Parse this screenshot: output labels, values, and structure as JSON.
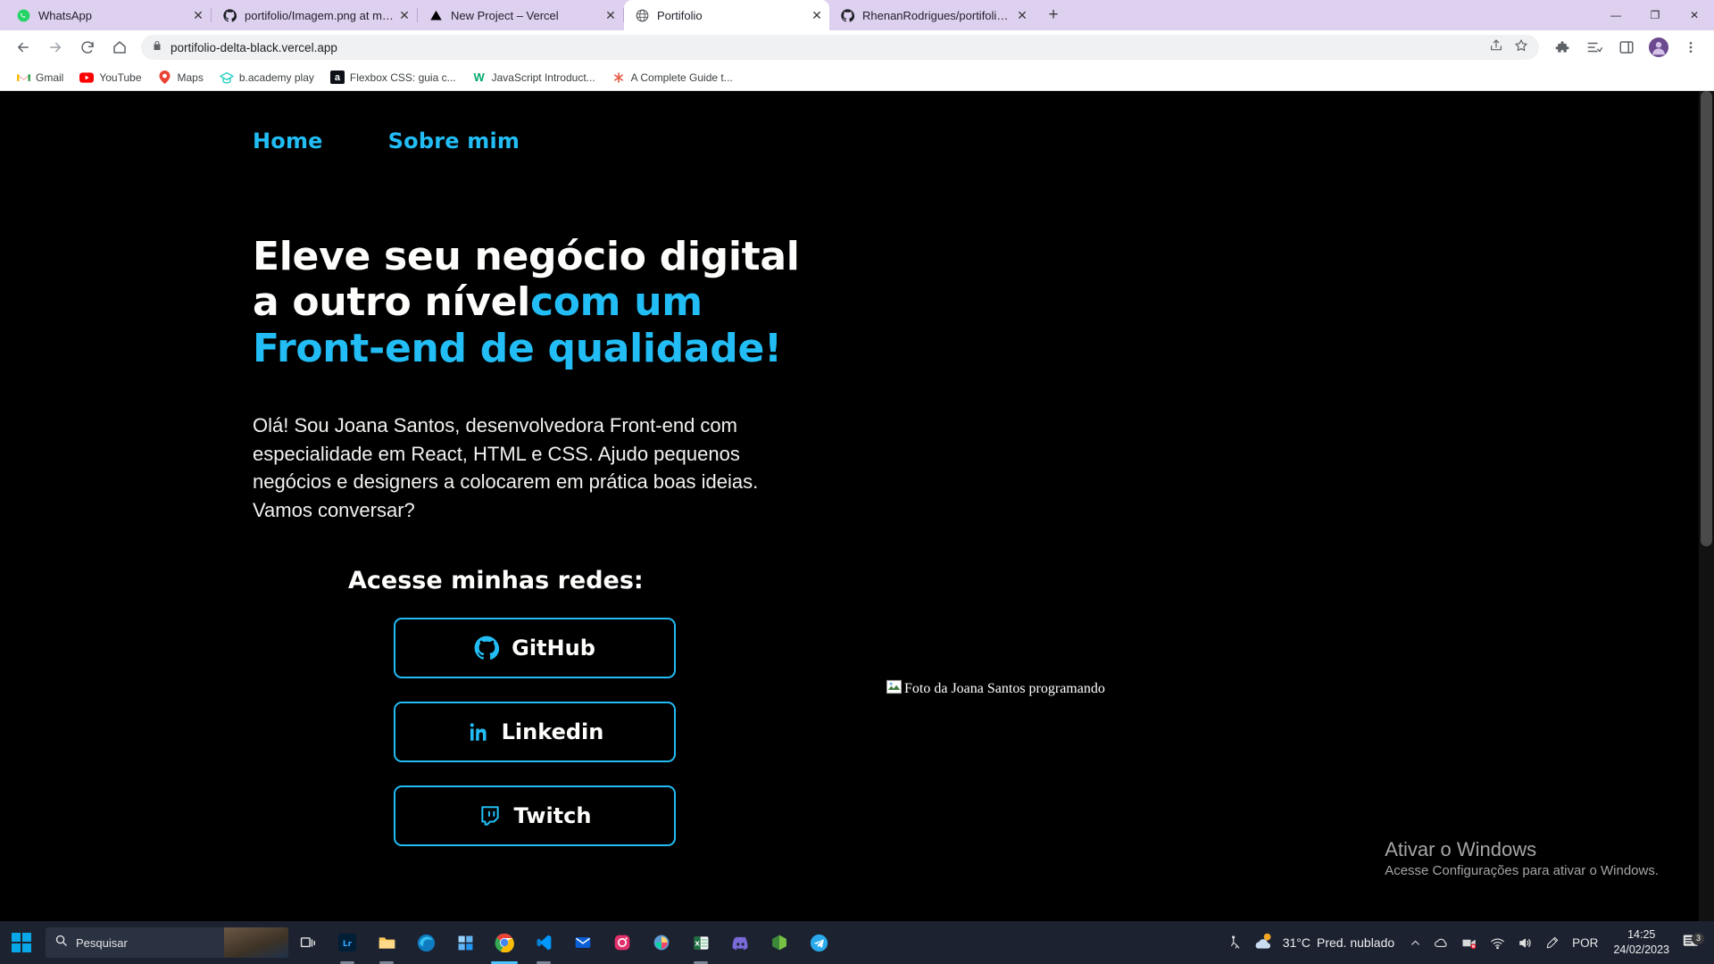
{
  "browser": {
    "tabs": [
      {
        "title": "WhatsApp",
        "favicon": "whatsapp-icon",
        "active": false
      },
      {
        "title": "portifolio/Imagem.png at main ·",
        "favicon": "github-icon",
        "active": false
      },
      {
        "title": "New Project – Vercel",
        "favicon": "vercel-icon",
        "active": false
      },
      {
        "title": "Portifolio",
        "favicon": "globe-icon",
        "active": true
      },
      {
        "title": "RhenanRodrigues/portifolio: Proj",
        "favicon": "github-icon",
        "active": false
      }
    ],
    "tab_close_label": "✕",
    "new_tab_label": "+",
    "window_controls": {
      "minimize": "—",
      "maximize": "❐",
      "close": "✕"
    },
    "toolbar": {
      "back": "back-arrow",
      "forward": "forward-arrow",
      "reload": "reload-icon",
      "home": "home-icon",
      "url": "portifolio-delta-black.vercel.app",
      "lock": "lock-icon",
      "share": "share-icon",
      "bookmark_star": "star-icon",
      "extensions": "puzzle-icon",
      "reading_list": "reading-list-icon",
      "side_panel": "side-panel-icon",
      "profile": "avatar",
      "menu": "kebab-menu-icon"
    },
    "bookmarks": [
      {
        "label": "Gmail",
        "icon": "gmail-icon"
      },
      {
        "label": "YouTube",
        "icon": "youtube-icon"
      },
      {
        "label": "Maps",
        "icon": "maps-icon"
      },
      {
        "label": "b.academy play",
        "icon": "bacademy-icon"
      },
      {
        "label": "Flexbox CSS: guia c...",
        "icon": "alura-icon"
      },
      {
        "label": "JavaScript Introduct...",
        "icon": "w3-icon"
      },
      {
        "label": "A Complete Guide t...",
        "icon": "csstricks-icon"
      }
    ]
  },
  "site": {
    "nav": [
      {
        "label": "Home"
      },
      {
        "label": "Sobre mim"
      }
    ],
    "headline": {
      "line1": "Eleve seu negócio digital",
      "line2": "a outro nível",
      "accent1": "com um",
      "accent2": "Front-end de qualidade!"
    },
    "lede": "Olá! Sou Joana Santos, desenvolvedora Front-end com especialidade em React, HTML e CSS. Ajudo pequenos negócios e designers a colocarem em prática boas ideias. Vamos conversar?",
    "redes_title": "Acesse minhas redes:",
    "socials": [
      {
        "label": "GitHub",
        "icon": "github-icon"
      },
      {
        "label": "Linkedin",
        "icon": "linkedin-icon"
      },
      {
        "label": "Twitch",
        "icon": "twitch-icon"
      }
    ],
    "broken_image": {
      "alt": "Foto da Joana Santos programando",
      "icon": "broken-image-icon"
    },
    "colors": {
      "accent": "#22bdf5",
      "background": "#000000",
      "text": "#fdfdfb"
    }
  },
  "windows": {
    "watermark": {
      "title": "Ativar o Windows",
      "subtitle": "Acesse Configurações para ativar o Windows."
    },
    "taskbar": {
      "start": "windows-start-icon",
      "search_placeholder": "Pesquisar",
      "items": [
        {
          "name": "task-view-icon"
        },
        {
          "name": "lightroom-icon"
        },
        {
          "name": "file-explorer-icon"
        },
        {
          "name": "edge-icon"
        },
        {
          "name": "microsoft-store-icon"
        },
        {
          "name": "chrome-icon"
        },
        {
          "name": "vscode-icon"
        },
        {
          "name": "mail-icon"
        },
        {
          "name": "instagram-icon"
        },
        {
          "name": "photos-icon"
        },
        {
          "name": "excel-icon"
        },
        {
          "name": "discord-icon"
        },
        {
          "name": "nodejs-icon"
        },
        {
          "name": "telegram-icon"
        }
      ],
      "tray": {
        "remote": "remote-desktop-icon",
        "weather_temp": "31°C",
        "weather_desc": "Pred. nublado",
        "chevron": "chevron-up-icon",
        "onedrive": "onedrive-icon",
        "camera_off": "camera-off-icon",
        "wifi": "wifi-icon",
        "volume": "volume-icon",
        "pen": "pen-icon",
        "language": "POR",
        "time": "14:25",
        "date": "24/02/2023",
        "notifications_count": "3"
      }
    }
  }
}
